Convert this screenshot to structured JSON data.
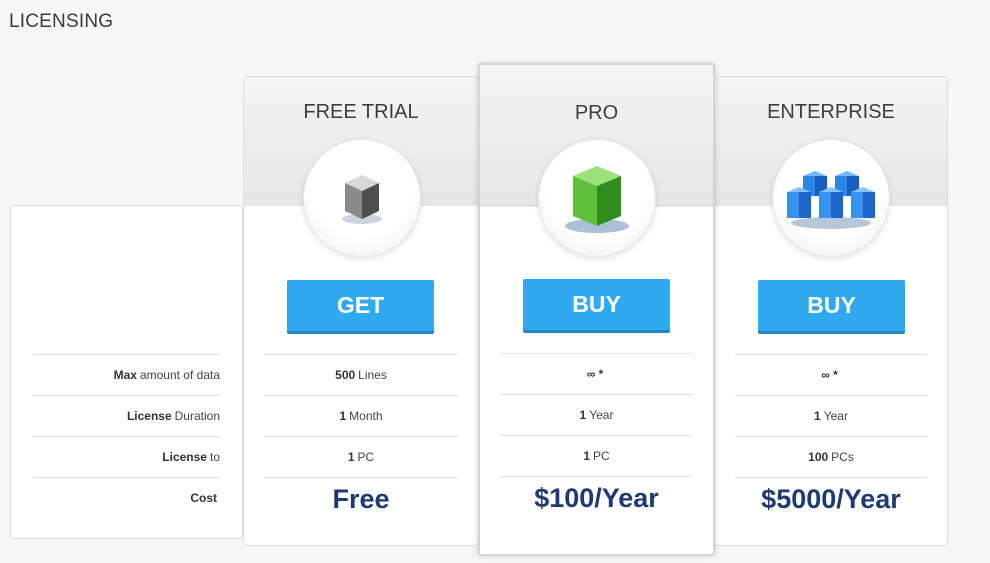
{
  "page": {
    "title": "LICENSING"
  },
  "labels": [
    {
      "bold": "Max",
      "rest": "amount of data"
    },
    {
      "bold": "License",
      "rest": "Duration"
    },
    {
      "bold": "License",
      "rest": "to"
    },
    {
      "bold": "Cost",
      "rest": ""
    }
  ],
  "plans": {
    "free": {
      "name": "FREE TRIAL",
      "button": "GET",
      "data": {
        "bold": "500",
        "rest": "Lines"
      },
      "duration": {
        "bold": "1",
        "rest": "Month"
      },
      "license_to": {
        "bold": "1",
        "rest": "PC"
      },
      "price": "Free",
      "icon": "gray-cube-icon"
    },
    "pro": {
      "name": "PRO",
      "button": "BUY",
      "data": {
        "bold": "∞ *",
        "rest": ""
      },
      "duration": {
        "bold": "1",
        "rest": "Year"
      },
      "license_to": {
        "bold": "1",
        "rest": "PC"
      },
      "price": "$100/Year",
      "icon": "green-cube-icon"
    },
    "enterprise": {
      "name": "ENTERPRISE",
      "button": "BUY",
      "data": {
        "bold": "∞ *",
        "rest": ""
      },
      "duration": {
        "bold": "1",
        "rest": "Year"
      },
      "license_to": {
        "bold": "100",
        "rest": "PCs"
      },
      "price": "$5000/Year",
      "icon": "blue-cubes-icon"
    }
  },
  "colors": {
    "button": "#2fa9ef",
    "price": "#1e3a72"
  }
}
